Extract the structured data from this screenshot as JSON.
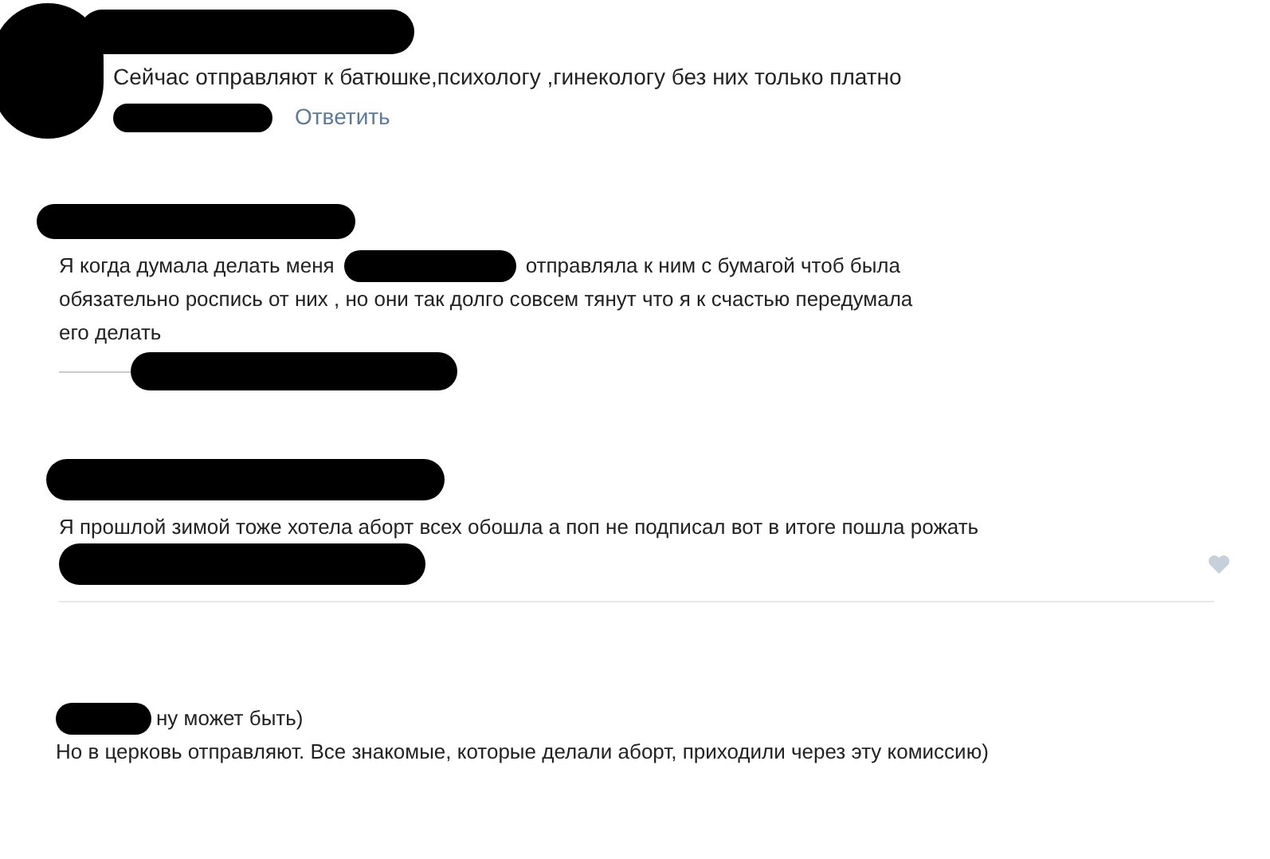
{
  "comments": [
    {
      "kind": "reply",
      "text": "Сейчас отправляют к батюшке,психологу ,гинекологу без них только платно",
      "action": "Ответить"
    },
    {
      "kind": "split",
      "text_before": "Я когда думала делать меня",
      "lines": [
        "отправляла к ним с бумагой чтоб была",
        "обязательно роспись от них , но они так долго совсем тянут что я к счастью передумала",
        "его делать"
      ]
    },
    {
      "kind": "plain",
      "text": "Я прошлой зимой тоже хотела аборт всех обошла а поп не подписал вот в итоге пошла рожать"
    },
    {
      "kind": "addressed",
      "first_line": "ну может быть)",
      "text": "Но в церковь отправляют. Все знакомые, которые делали аборт, приходили через эту комиссию)"
    }
  ]
}
